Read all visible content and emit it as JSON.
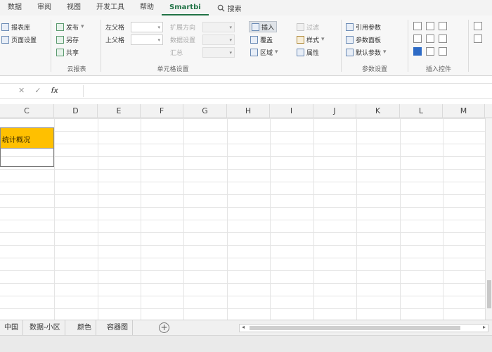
{
  "ribbon_tabs": [
    "数据",
    "审阅",
    "视图",
    "开发工具",
    "帮助",
    "Smartbi"
  ],
  "active_tab_index": 5,
  "search_label": "搜索",
  "ribbon": {
    "g1": {
      "btn1": "报表库",
      "btn2": "页面设置"
    },
    "g2": {
      "btn1": "发布",
      "btn2": "另存",
      "btn3": "共享",
      "title": "云报表"
    },
    "g3": {
      "label1": "左父格",
      "label2": "上父格",
      "label3": "扩展方向",
      "label4": "数据设置",
      "label5": "汇总",
      "title": "单元格设置"
    },
    "g4": {
      "btn1": "插入",
      "btn2": "覆盖",
      "btn3": "区域",
      "btn4": "过滤",
      "btn5": "样式",
      "btn6": "属性"
    },
    "g5": {
      "btn1": "引用参数",
      "btn2": "参数面板",
      "btn3": "默认参数",
      "title": "参数设置"
    },
    "g6": {
      "title": "插入控件"
    }
  },
  "formula_bar": {
    "fx": "fx"
  },
  "columns": [
    "C",
    "D",
    "E",
    "F",
    "G",
    "H",
    "I",
    "J",
    "K",
    "L",
    "M"
  ],
  "cells": {
    "c2": "统计概况"
  },
  "sheet_tabs": [
    "中国",
    "数据-小区",
    "颜色",
    "容器图"
  ],
  "colors": {
    "accent": "#217346",
    "highlight": "#ffc000"
  }
}
